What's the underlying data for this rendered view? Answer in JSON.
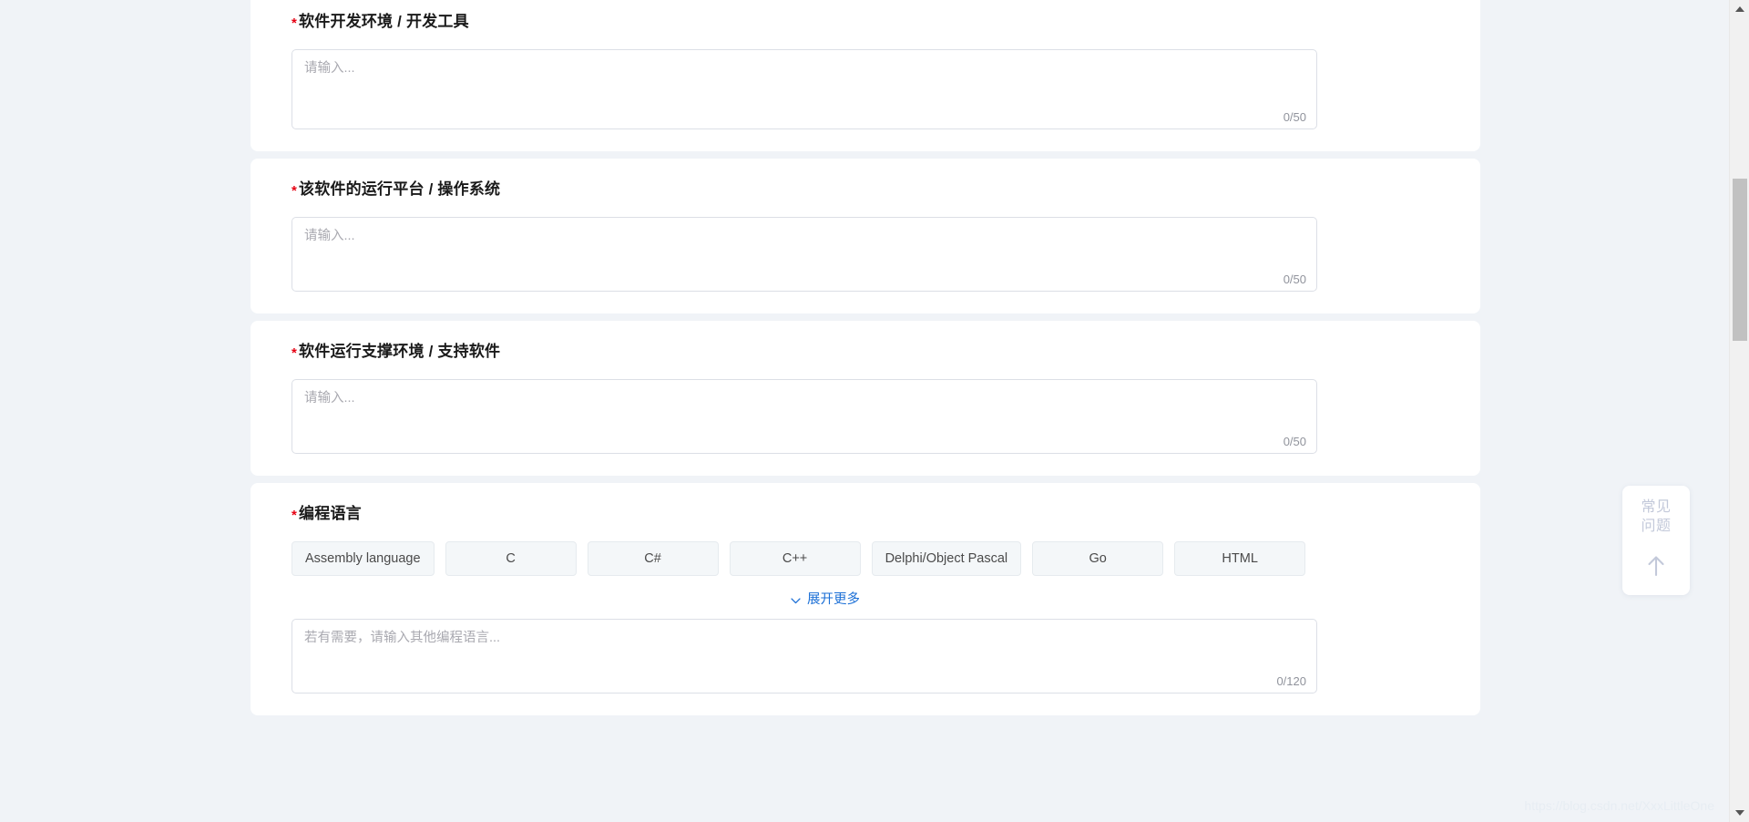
{
  "page": {
    "background_color": "#f0f3f7",
    "card_color": "#ffffff",
    "accent_color": "#1b6fd6",
    "required_star_color": "#e60012"
  },
  "fields": [
    {
      "label": "软件开发环境 / 开发工具",
      "required_mark": "*",
      "placeholder": "请输入...",
      "value": "",
      "counter": "0/50"
    },
    {
      "label": "该软件的运行平台 / 操作系统",
      "required_mark": "*",
      "placeholder": "请输入...",
      "value": "",
      "counter": "0/50"
    },
    {
      "label": "软件运行支撑环境 / 支持软件",
      "required_mark": "*",
      "placeholder": "请输入...",
      "value": "",
      "counter": "0/50"
    }
  ],
  "language_section": {
    "label": "编程语言",
    "required_mark": "*",
    "options": [
      "Assembly language",
      "C",
      "C#",
      "C++",
      "Delphi/Object Pascal",
      "Go",
      "HTML"
    ],
    "expand_label": "展开更多",
    "expand_icon": "chevron-down-icon",
    "other_placeholder": "若有需要，请输入其他编程语言...",
    "other_value": "",
    "other_counter": "0/120"
  },
  "faq_widget": {
    "line1": "常见",
    "line2": "问题",
    "arrow_icon": "arrow-up-icon"
  },
  "watermark": {
    "text": "https://blog.csdn.net/XxxLittleOne"
  },
  "scrollbar": {
    "up_icon": "triangle-up-icon",
    "down_icon": "triangle-down-icon"
  }
}
